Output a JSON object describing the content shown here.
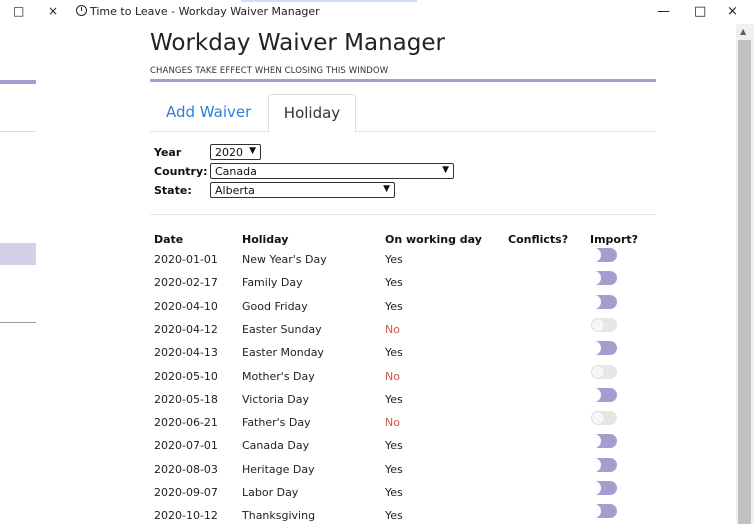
{
  "window": {
    "title": "Time to Leave - Workday Waiver Manager",
    "left_buttons": [
      "□",
      "×"
    ],
    "controls": [
      "—",
      "□",
      "×"
    ]
  },
  "page": {
    "title": "Workday Waiver Manager",
    "subtitle": "CHANGES TAKE EFFECT WHEN CLOSING THIS WINDOW"
  },
  "tabs": [
    {
      "label": "Add Waiver",
      "active": false
    },
    {
      "label": "Holiday",
      "active": true
    }
  ],
  "form": {
    "year_label": "Year",
    "year_value": "2020",
    "country_label": "Country:",
    "country_value": "Canada",
    "state_label": "State:",
    "state_value": "Alberta"
  },
  "table": {
    "headers": [
      "Date",
      "Holiday",
      "On working day",
      "Conflicts?",
      "Import?"
    ],
    "rows": [
      {
        "date": "2020-01-01",
        "holiday": "New Year's Day",
        "working": "Yes",
        "conflicts": "",
        "import": true
      },
      {
        "date": "2020-02-17",
        "holiday": "Family Day",
        "working": "Yes",
        "conflicts": "",
        "import": true
      },
      {
        "date": "2020-04-10",
        "holiday": "Good Friday",
        "working": "Yes",
        "conflicts": "",
        "import": true
      },
      {
        "date": "2020-04-12",
        "holiday": "Easter Sunday",
        "working": "No",
        "conflicts": "",
        "import": false
      },
      {
        "date": "2020-04-13",
        "holiday": "Easter Monday",
        "working": "Yes",
        "conflicts": "",
        "import": true
      },
      {
        "date": "2020-05-10",
        "holiday": "Mother's Day",
        "working": "No",
        "conflicts": "",
        "import": false
      },
      {
        "date": "2020-05-18",
        "holiday": "Victoria Day",
        "working": "Yes",
        "conflicts": "",
        "import": true
      },
      {
        "date": "2020-06-21",
        "holiday": "Father's Day",
        "working": "No",
        "conflicts": "",
        "import": false
      },
      {
        "date": "2020-07-01",
        "holiday": "Canada Day",
        "working": "Yes",
        "conflicts": "",
        "import": true
      },
      {
        "date": "2020-08-03",
        "holiday": "Heritage Day",
        "working": "Yes",
        "conflicts": "",
        "import": true
      },
      {
        "date": "2020-09-07",
        "holiday": "Labor Day",
        "working": "Yes",
        "conflicts": "",
        "import": true
      },
      {
        "date": "2020-10-12",
        "holiday": "Thanksgiving",
        "working": "Yes",
        "conflicts": "",
        "import": true
      }
    ]
  },
  "colors": {
    "accent_purple": "#a79bd0",
    "link_blue": "#2f7dd8",
    "no_red": "#d9534f"
  }
}
